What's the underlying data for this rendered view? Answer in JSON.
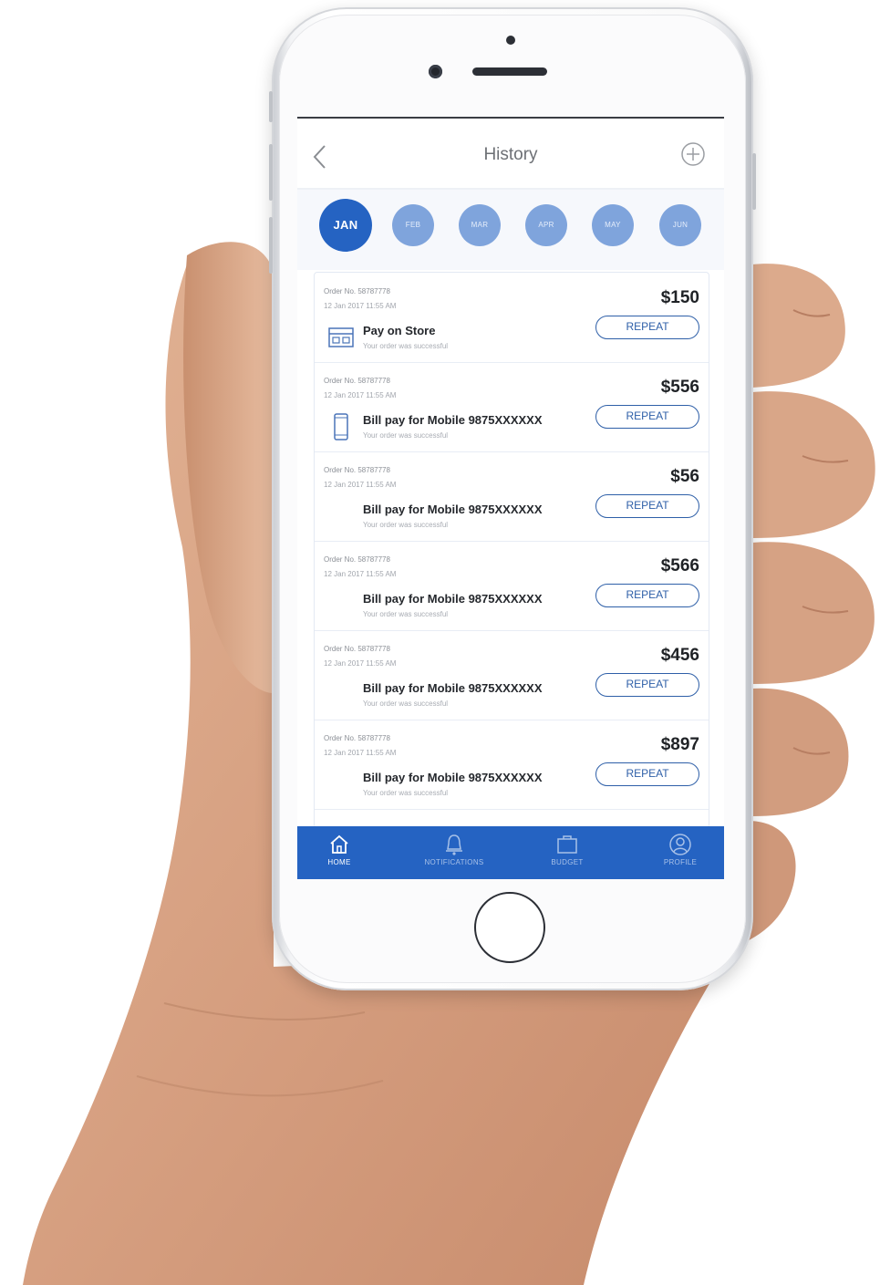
{
  "header": {
    "title": "History"
  },
  "months": [
    {
      "label": "JAN",
      "active": true
    },
    {
      "label": "FEB",
      "active": false
    },
    {
      "label": "MAR",
      "active": false
    },
    {
      "label": "APR",
      "active": false
    },
    {
      "label": "MAY",
      "active": false
    },
    {
      "label": "JUN",
      "active": false
    }
  ],
  "orders": [
    {
      "order_no": "Order No. 58787778",
      "date": "12 Jan 2017 11:55 AM",
      "title": "Pay on Store",
      "message": "Your order was successful",
      "amount": "$150",
      "button": "REPEAT",
      "icon": "store-icon"
    },
    {
      "order_no": "Order No. 58787778",
      "date": "12 Jan 2017 11:55 AM",
      "title": "Bill pay for Mobile  9875XXXXXX",
      "message": "Your order was successful",
      "amount": "$556",
      "button": "REPEAT",
      "icon": "mobile-icon"
    },
    {
      "order_no": "Order No. 58787778",
      "date": "12 Jan 2017 11:55 AM",
      "title": "Bill pay for Mobile  9875XXXXXX",
      "message": "Your order was successful",
      "amount": "$56",
      "button": "REPEAT",
      "icon": ""
    },
    {
      "order_no": "Order No. 58787778",
      "date": "12 Jan 2017 11:55 AM",
      "title": "Bill pay for Mobile  9875XXXXXX",
      "message": "Your order was successful",
      "amount": "$566",
      "button": "REPEAT",
      "icon": ""
    },
    {
      "order_no": "Order No. 58787778",
      "date": "12 Jan 2017 11:55 AM",
      "title": "Bill pay for Mobile  9875XXXXXX",
      "message": "Your order was successful",
      "amount": "$456",
      "button": "REPEAT",
      "icon": ""
    },
    {
      "order_no": "Order No. 58787778",
      "date": "12 Jan 2017 11:55 AM",
      "title": "Bill pay for Mobile  9875XXXXXX",
      "message": "Your order was successful",
      "amount": "$897",
      "button": "REPEAT",
      "icon": ""
    }
  ],
  "tabs": [
    {
      "label": "HOME",
      "icon": "home-icon",
      "active": true
    },
    {
      "label": "NOTIFICATIONS",
      "icon": "bell-icon",
      "active": false
    },
    {
      "label": "BUDGET",
      "icon": "briefcase-icon",
      "active": false
    },
    {
      "label": "PROFILE",
      "icon": "user-icon",
      "active": false
    }
  ],
  "colors": {
    "primary": "#2563c2",
    "month_inactive": "#7fa4dc",
    "repeat_border": "#2e5fa8"
  }
}
